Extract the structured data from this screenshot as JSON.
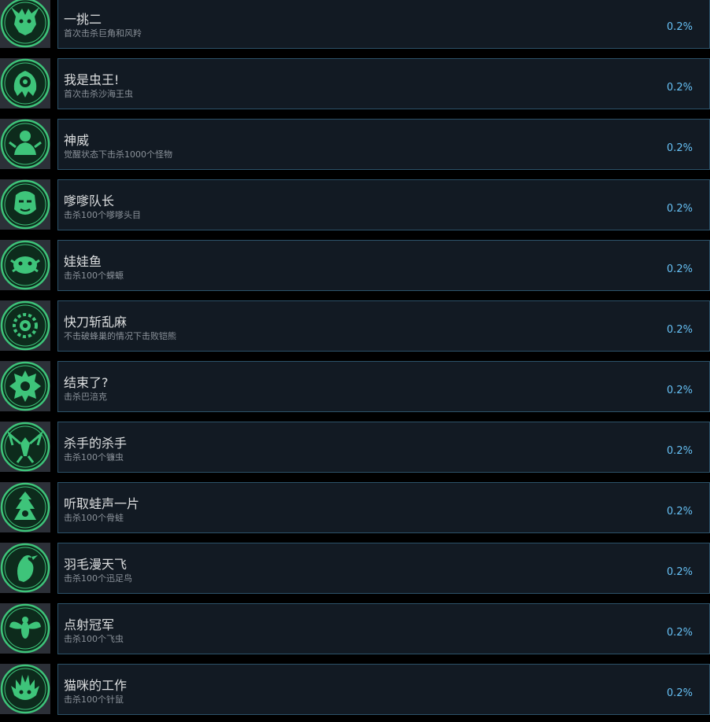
{
  "achievements": [
    {
      "title": "一挑二",
      "description": "首次击杀巨角和风羚",
      "percent": "0.2%",
      "icon": "horned-beast-emblem-icon"
    },
    {
      "title": "我是虫王!",
      "description": "首次击杀沙海王虫",
      "percent": "0.2%",
      "icon": "sandworm-king-emblem-icon"
    },
    {
      "title": "神威",
      "description": "觉醒状态下击杀1000个怪物",
      "percent": "0.2%",
      "icon": "awakened-warrior-emblem-icon"
    },
    {
      "title": "嗲嗲队长",
      "description": "击杀100个嗲嗲头目",
      "percent": "0.2%",
      "icon": "captain-mask-emblem-icon"
    },
    {
      "title": "娃娃鱼",
      "description": "击杀100个蝾螈",
      "percent": "0.2%",
      "icon": "salamander-emblem-icon"
    },
    {
      "title": "快刀斩乱麻",
      "description": "不击破蜂巢的情况下击败铠熊",
      "percent": "0.2%",
      "icon": "ornate-ring-emblem-icon"
    },
    {
      "title": "结束了?",
      "description": "击杀巴涪克",
      "percent": "0.2%",
      "icon": "spiked-boss-emblem-icon"
    },
    {
      "title": "杀手的杀手",
      "description": "击杀100个镰虫",
      "percent": "0.2%",
      "icon": "mantis-emblem-icon"
    },
    {
      "title": "听取蛙声一片",
      "description": "击杀100个骨蛙",
      "percent": "0.2%",
      "icon": "frog-totem-emblem-icon"
    },
    {
      "title": "羽毛漫天飞",
      "description": "击杀100个迅足鸟",
      "percent": "0.2%",
      "icon": "feathered-bird-emblem-icon"
    },
    {
      "title": "点射冠军",
      "description": "击杀100个飞虫",
      "percent": "0.2%",
      "icon": "flying-insect-emblem-icon"
    },
    {
      "title": "猫咪的工作",
      "description": "击杀100个针鼠",
      "percent": "0.2%",
      "icon": "spiny-rat-emblem-icon"
    }
  ],
  "colors": {
    "emblem_green": "#3ec47a",
    "emblem_dark": "#0d2b1c",
    "card_background": "#121a23",
    "card_border": "#2c5269",
    "percent_blue": "#66c0f4",
    "title_text": "#dcdedf",
    "description_text": "#8b929a"
  }
}
